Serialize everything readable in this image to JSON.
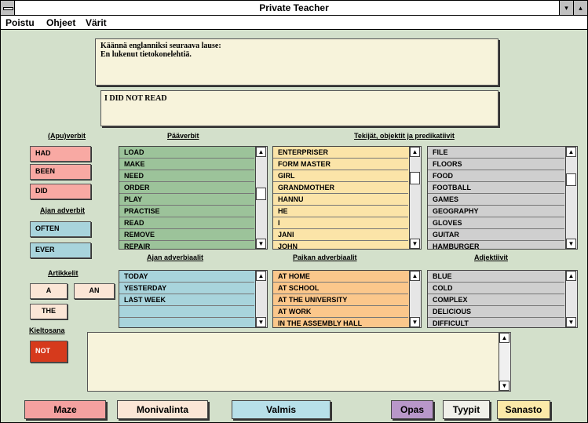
{
  "window": {
    "title": "Private Teacher",
    "minimize_glyph": "▾",
    "maximize_glyph": "▴"
  },
  "menu": [
    "Poistu",
    "Ohjeet",
    "Värit"
  ],
  "prompt": {
    "line1": "Käännä englanniksi seuraava lause:",
    "line2": "En lukenut tietokonelehtiä."
  },
  "answer": {
    "text": "I DID NOT READ"
  },
  "headers": {
    "aux_verbs": "(Apu)verbit",
    "main_verbs": "Pääverbit",
    "actors": "Tekijät, objektit ja predikatiivit",
    "time_adverbs": "Ajan adverbit",
    "time_adverbials": "Ajan adverbiaalit",
    "place_adverbials": "Paikan adverbiaalit",
    "adjectives": "Adjektiivit",
    "articles": "Artikkelit",
    "negation": "Kieltosana"
  },
  "aux_verbs": [
    "HAD",
    "BEEN",
    "DID"
  ],
  "time_adverbs": [
    "OFTEN",
    "EVER"
  ],
  "articles": [
    "A",
    "AN",
    "THE"
  ],
  "negation": [
    "NOT"
  ],
  "lists": {
    "main_verbs": [
      "LOAD",
      "MAKE",
      "NEED",
      "ORDER",
      "PLAY",
      "PRACTISE",
      "READ",
      "REMOVE",
      "REPAIR"
    ],
    "actors1": [
      "ENTERPRISER",
      "FORM MASTER",
      "GIRL",
      "GRANDMOTHER",
      "HANNU",
      "HE",
      "I",
      "JANI",
      "JOHN"
    ],
    "actors2": [
      "FILE",
      "FLOORS",
      "FOOD",
      "FOOTBALL",
      "GAMES",
      "GEOGRAPHY",
      "GLOVES",
      "GUITAR",
      "HAMBURGER"
    ],
    "time_adverbials": [
      "TODAY",
      "YESTERDAY",
      "LAST WEEK"
    ],
    "place_adverbials": [
      "AT HOME",
      "AT SCHOOL",
      "AT THE UNIVERSITY",
      "AT WORK",
      "IN THE ASSEMBLY HALL"
    ],
    "adjectives": [
      "BLUE",
      "COLD",
      "COMPLEX",
      "DELICIOUS",
      "DIFFICULT"
    ]
  },
  "scroll": {
    "up_glyph": "▲",
    "down_glyph": "▼"
  },
  "buttons": {
    "maze": "Maze",
    "multichoice": "Monivalinta",
    "done": "Valmis",
    "guide": "Opas",
    "types": "Tyypit",
    "vocab": "Sanasto"
  },
  "colors": {
    "background": "#d3e0cb",
    "aux_verb": "#f8a9a3",
    "time_adverb": "#a8d4dc",
    "article": "#fbe6d6",
    "negation": "#d63a1c",
    "main_verbs_list": "#9cc39a",
    "actors1_list": "#fbe4a8",
    "actors2_list": "#cfcfcf",
    "time_list": "#a8d4dc",
    "place_list": "#fbc78b",
    "adj_list": "#cfcfcf",
    "panel": "#f7f3db",
    "maze": "#f4a1a0",
    "multichoice": "#fbe6d6",
    "done": "#b7e0e9",
    "guide": "#b897c9",
    "types": "#f0f0ea",
    "vocab": "#fbe9a8"
  }
}
